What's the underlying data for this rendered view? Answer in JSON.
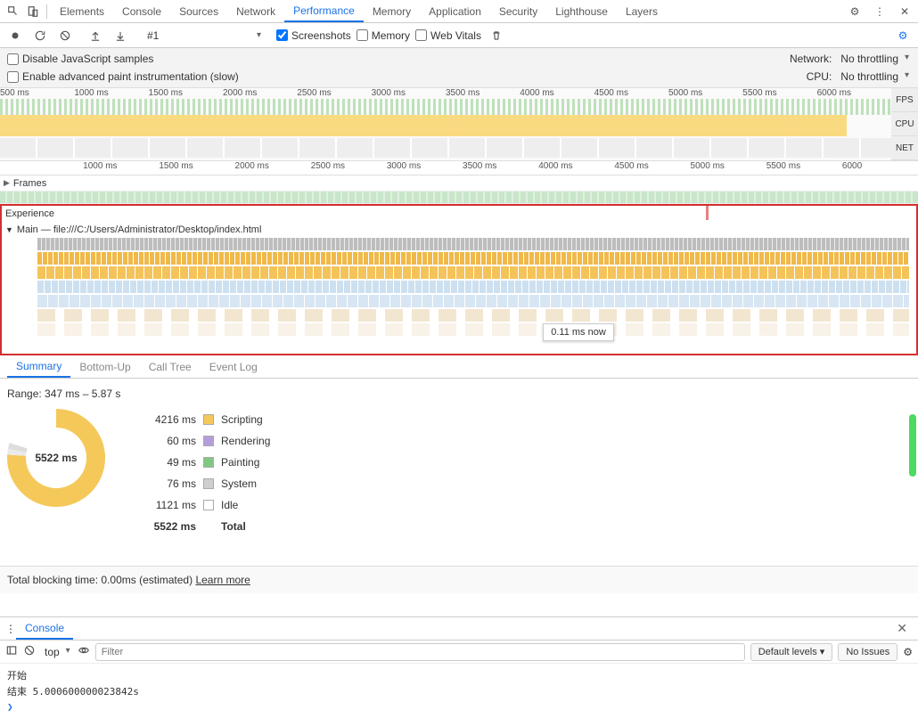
{
  "main_tabs": [
    "Elements",
    "Console",
    "Sources",
    "Network",
    "Performance",
    "Memory",
    "Application",
    "Security",
    "Lighthouse",
    "Layers"
  ],
  "main_tab_active": "Performance",
  "recording_selector": "#1",
  "toolbar_checkboxes": {
    "screenshots": {
      "label": "Screenshots",
      "checked": true
    },
    "memory": {
      "label": "Memory",
      "checked": false
    },
    "webvitals": {
      "label": "Web Vitals",
      "checked": false
    }
  },
  "settings": {
    "disable_js_samples": {
      "label": "Disable JavaScript samples",
      "checked": false
    },
    "enable_paint_instr": {
      "label": "Enable advanced paint instrumentation (slow)",
      "checked": false
    },
    "network": {
      "label": "Network:",
      "value": "No throttling"
    },
    "cpu": {
      "label": "CPU:",
      "value": "No throttling"
    }
  },
  "overview": {
    "ticks": [
      "500 ms",
      "1000 ms",
      "1500 ms",
      "2000 ms",
      "2500 ms",
      "3000 ms",
      "3500 ms",
      "4000 ms",
      "4500 ms",
      "5000 ms",
      "5500 ms",
      "6000 ms"
    ],
    "labels": [
      "FPS",
      "CPU",
      "NET"
    ]
  },
  "ruler": [
    "",
    "1000 ms",
    "1500 ms",
    "2000 ms",
    "2500 ms",
    "3000 ms",
    "3500 ms",
    "4000 ms",
    "4500 ms",
    "5000 ms",
    "5500 ms",
    "6000"
  ],
  "sections": {
    "frames": "Frames",
    "experience": "Experience",
    "main": "Main — file:///C:/Users/Administrator/Desktop/index.html"
  },
  "tooltip": "0.11 ms  now",
  "detail_tabs": [
    "Summary",
    "Bottom-Up",
    "Call Tree",
    "Event Log"
  ],
  "detail_tab_active": "Summary",
  "summary": {
    "range": "Range: 347 ms – 5.87 s",
    "center": "5522 ms",
    "legend": [
      {
        "time": "4216 ms",
        "swatch": "#f5c85a",
        "name": "Scripting"
      },
      {
        "time": "60 ms",
        "swatch": "#b39ddb",
        "name": "Rendering"
      },
      {
        "time": "49 ms",
        "swatch": "#81c784",
        "name": "Painting"
      },
      {
        "time": "76 ms",
        "swatch": "#cfcfcf",
        "name": "System"
      },
      {
        "time": "1121 ms",
        "swatch": "#ffffff",
        "name": "Idle"
      }
    ],
    "total_time": "5522 ms",
    "total_label": "Total"
  },
  "blocking": {
    "text": "Total blocking time: 0.00ms (estimated)",
    "link": "Learn more"
  },
  "console": {
    "tab": "Console",
    "context": "top",
    "filter_placeholder": "Filter",
    "levels": "Default levels",
    "no_issues": "No Issues",
    "lines": [
      "开始",
      "结束 5.000600000023842s"
    ]
  },
  "chart_data": {
    "type": "pie",
    "title": "Performance Summary",
    "series": [
      {
        "name": "Scripting",
        "value": 4216,
        "unit": "ms",
        "color": "#f5c85a"
      },
      {
        "name": "Rendering",
        "value": 60,
        "unit": "ms",
        "color": "#b39ddb"
      },
      {
        "name": "Painting",
        "value": 49,
        "unit": "ms",
        "color": "#81c784"
      },
      {
        "name": "System",
        "value": 76,
        "unit": "ms",
        "color": "#cfcfcf"
      },
      {
        "name": "Idle",
        "value": 1121,
        "unit": "ms",
        "color": "#ffffff"
      }
    ],
    "total": 5522,
    "range_ms": [
      347,
      5870
    ]
  }
}
